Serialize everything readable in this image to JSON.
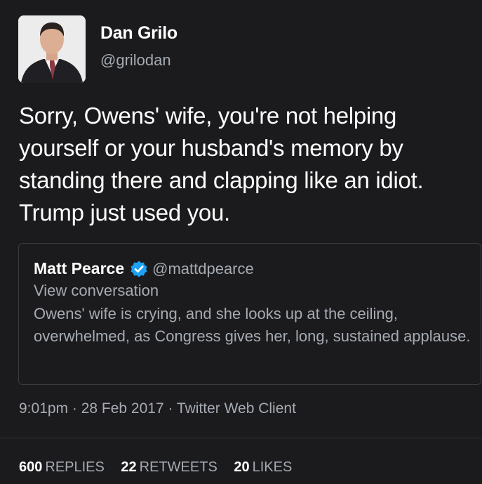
{
  "tweet": {
    "author": {
      "name": "Dan Grilo",
      "handle": "@grilodan"
    },
    "text": "Sorry, Owens' wife, you're not helping yourself or your husband's memory by standing there and clapping like an idiot. Trump just used you.",
    "quoted": {
      "name": "Matt Pearce",
      "handle": "@mattdpearce",
      "verified": true,
      "view_conversation": "View conversation",
      "text": "Owens' wife is crying, and she looks up at the ceiling, overwhelmed, as Congress gives her, long, sustained applause."
    },
    "meta": "9:01pm · 28 Feb 2017 · Twitter Web Client",
    "stats": {
      "replies": {
        "count": "600",
        "label": "REPLIES"
      },
      "retweets": {
        "count": "22",
        "label": "RETWEETS"
      },
      "likes": {
        "count": "20",
        "label": "LIKES"
      }
    }
  },
  "colors": {
    "background": "#1b1b1d",
    "text_primary": "#ffffff",
    "text_secondary": "#a6abb3",
    "verified_blue": "#1da1f2"
  },
  "icons": {
    "avatar": "avatar-photo",
    "verified": "verified-badge-icon"
  }
}
